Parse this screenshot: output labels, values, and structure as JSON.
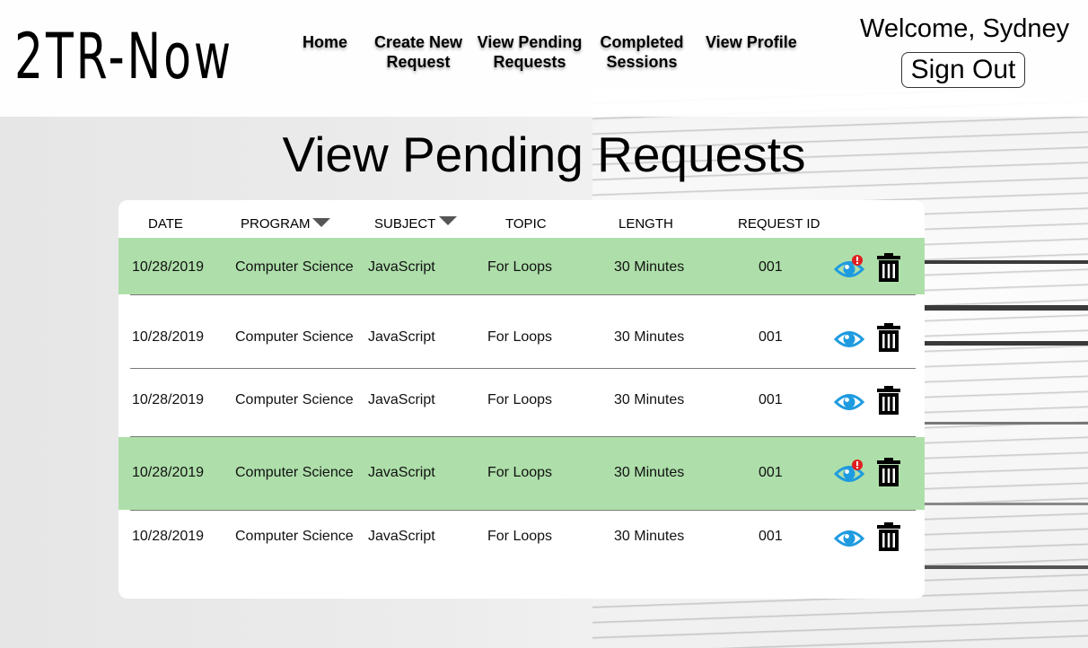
{
  "app": {
    "logo": "2TR-Now"
  },
  "nav": [
    {
      "label": "Home"
    },
    {
      "label": "Create New\nRequest"
    },
    {
      "label": "View Pending\nRequests"
    },
    {
      "label": "Completed\nSessions"
    },
    {
      "label": "View Profile"
    }
  ],
  "user": {
    "welcome": "Welcome, Sydney",
    "signout_label": "Sign Out"
  },
  "page": {
    "title": "View Pending Requests"
  },
  "table": {
    "columns": [
      "DATE",
      "PROGRAM",
      "SUBJECT",
      "TOPIC",
      "LENGTH",
      "REQUEST ID"
    ],
    "rows": [
      {
        "date": "10/28/2019",
        "program": "Computer Science",
        "subject": "JavaScript",
        "topic": "For Loops",
        "length": "30 Minutes",
        "request_id": "001",
        "highlighted": true,
        "alert": true
      },
      {
        "date": "10/28/2019",
        "program": "Computer Science",
        "subject": "JavaScript",
        "topic": "For Loops",
        "length": "30 Minutes",
        "request_id": "001",
        "highlighted": false,
        "alert": false
      },
      {
        "date": "10/28/2019",
        "program": "Computer Science",
        "subject": "JavaScript",
        "topic": "For Loops",
        "length": "30 Minutes",
        "request_id": "001",
        "highlighted": false,
        "alert": false
      },
      {
        "date": "10/28/2019",
        "program": "Computer Science",
        "subject": "JavaScript",
        "topic": "For Loops",
        "length": "30 Minutes",
        "request_id": "001",
        "highlighted": true,
        "alert": true
      },
      {
        "date": "10/28/2019",
        "program": "Computer Science",
        "subject": "JavaScript",
        "topic": "For Loops",
        "length": "30 Minutes",
        "request_id": "001",
        "highlighted": false,
        "alert": false
      }
    ]
  },
  "icons": {
    "view": "eye-icon",
    "delete": "trash-icon",
    "alert": "alert-badge-icon",
    "sort": "caret-down-icon"
  },
  "colors": {
    "highlight_row": "#aedfaa",
    "eye": "#1e9be0",
    "alert": "#e02020"
  }
}
